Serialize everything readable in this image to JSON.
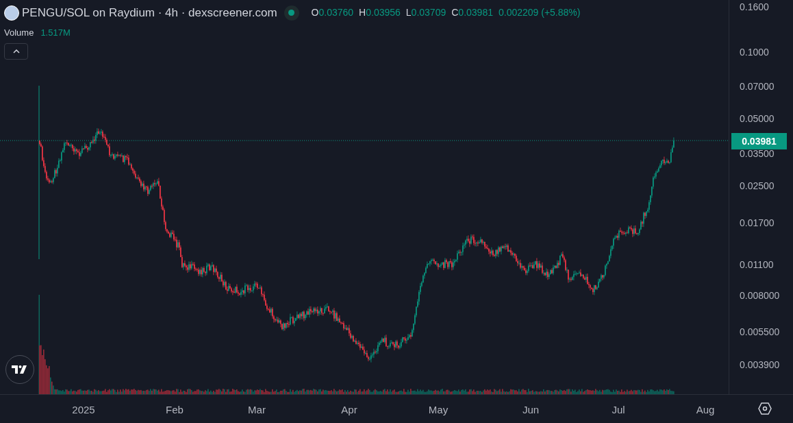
{
  "header": {
    "title": "PENGU/SOL on Raydium · 4h · dexscreener.com",
    "ohlc": [
      {
        "label": "O",
        "value": "0.03760"
      },
      {
        "label": "H",
        "value": "0.03956"
      },
      {
        "label": "L",
        "value": "0.03709"
      },
      {
        "label": "C",
        "value": "0.03981"
      }
    ],
    "change": "0.002209 (+5.88%)"
  },
  "volume": {
    "label": "Volume",
    "value": "1.517M"
  },
  "price_axis": {
    "ticks": [
      "0.1600",
      "0.1000",
      "0.07000",
      "0.05000",
      "0.03500",
      "0.02500",
      "0.01700",
      "0.01100",
      "0.008000",
      "0.005500",
      "0.003900"
    ],
    "current_price": "0.03981"
  },
  "time_axis": {
    "labels": [
      "2025",
      "Feb",
      "Mar",
      "Apr",
      "May",
      "Jun",
      "Jul",
      "Aug"
    ]
  }
}
